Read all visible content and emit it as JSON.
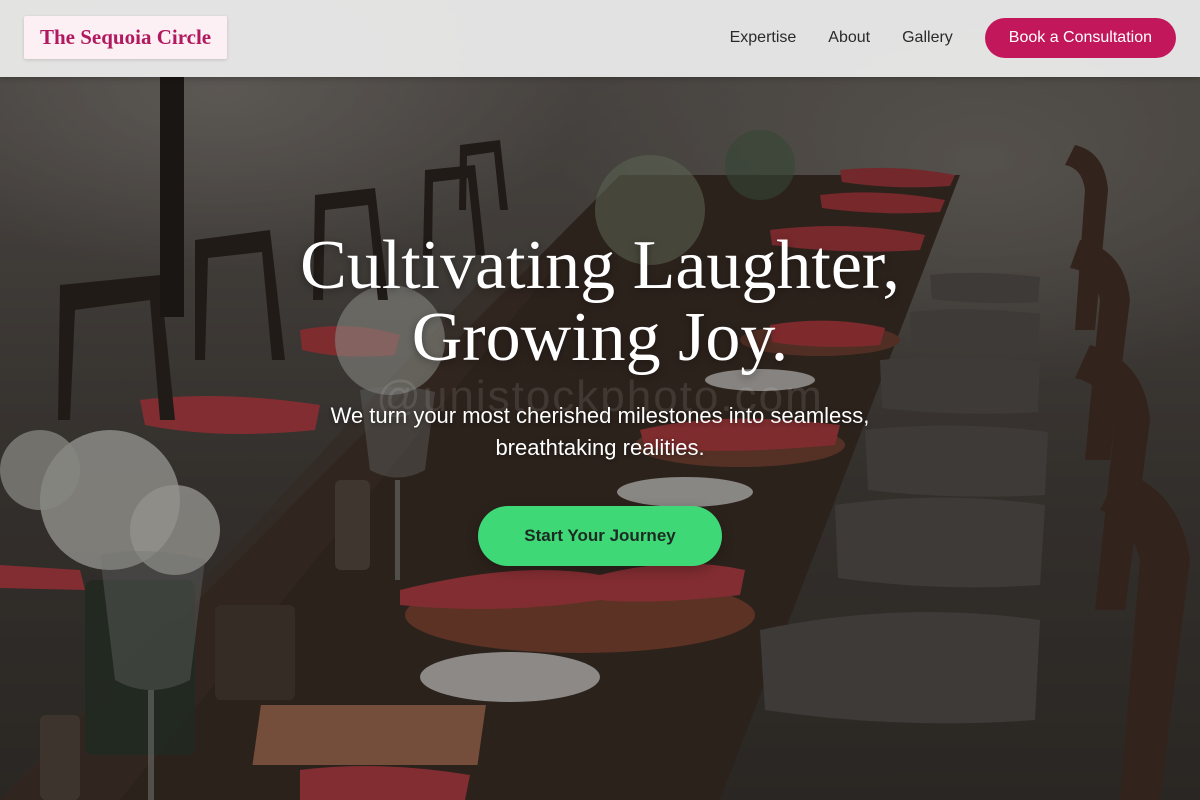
{
  "brand": {
    "name": "The Sequoia Circle",
    "color": "#b0195e"
  },
  "nav": {
    "links": [
      {
        "label": "Expertise"
      },
      {
        "label": "About"
      },
      {
        "label": "Gallery"
      }
    ],
    "cta_label": "Book a Consultation",
    "cta_color": "#c2185b"
  },
  "hero": {
    "title_line1": "Cultivating Laughter,",
    "title_line2": "Growing Joy.",
    "subtitle_line1": "We turn your most cherished milestones into seamless,",
    "subtitle_line2": "breathtaking realities.",
    "cta_label": "Start Your Journey",
    "cta_color": "#3fd877",
    "background_image": "outdoor-dining-table-scene",
    "watermark": "@unistockphoto.com"
  }
}
